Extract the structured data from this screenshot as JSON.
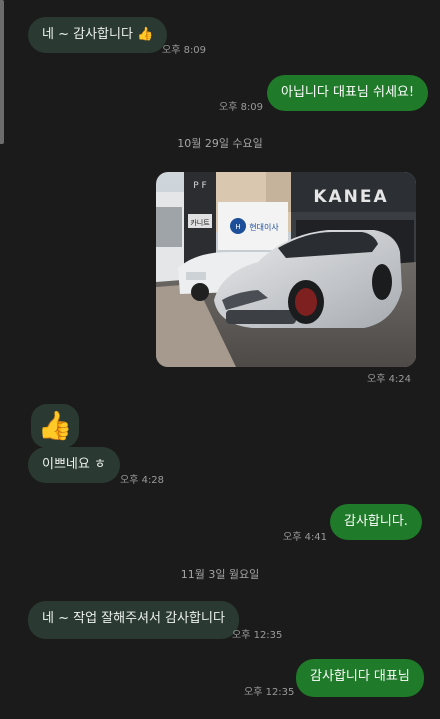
{
  "messages": {
    "m1": {
      "text": "네 ~ 감사합니다 👍",
      "time": "오후 8:09"
    },
    "m2": {
      "text": "아닙니다 대표님 쉬세요!",
      "time": "오후 8:09"
    },
    "date1": "10월 29일 수요일",
    "m3": {
      "image_alt": "car photo",
      "time": "오후 4:24",
      "signs": {
        "brand": "KANEA",
        "shop": "현대이사",
        "side": "카니트",
        "pillar": "P F"
      }
    },
    "m4": {
      "emoji": "👍"
    },
    "m5": {
      "text": "이쁘네요 ㅎ",
      "time": "오후 4:28"
    },
    "m6": {
      "text": "감사합니다.",
      "time": "오후 4:41"
    },
    "date2": "11월 3일 월요일",
    "m7": {
      "text": "네 ~ 작업 잘해주셔서 감사합니다",
      "time": "오후 12:35"
    },
    "m8": {
      "text": "감사합니다 대표님",
      "time": "오후 12:35"
    }
  },
  "colors": {
    "background": "#1b1b1b",
    "incoming_bubble": "#2a3a32",
    "outgoing_bubble": "#1f7a29",
    "timestamp": "#9a9a9a"
  }
}
